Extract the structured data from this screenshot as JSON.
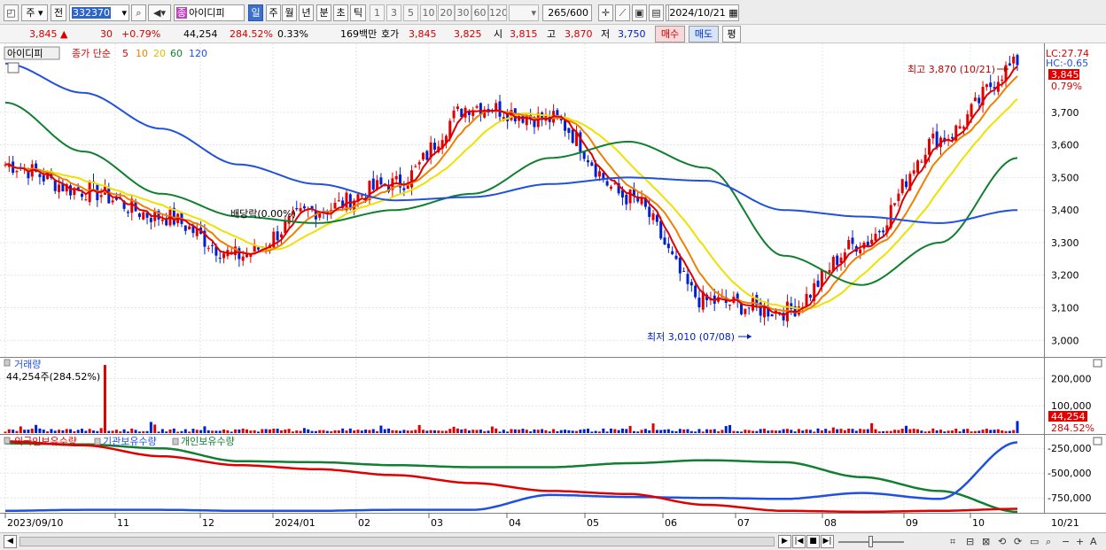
{
  "toolbar": {
    "market": "주",
    "prev_label": "전",
    "stock_code": "332370",
    "stock_name_prefix": "종",
    "stock_name": "아이디피",
    "period_tabs": [
      "일",
      "주",
      "월",
      "년",
      "분",
      "초",
      "틱"
    ],
    "active_period": "일",
    "interval_options": [
      "1",
      "3",
      "5",
      "10",
      "20",
      "30",
      "60",
      "120"
    ],
    "display_count": "265",
    "display_total": "/600",
    "date": "2024/10/21"
  },
  "quote": {
    "price": "3,845 ▲",
    "change": "30",
    "change_pct": "+0.79%",
    "volume": "44,254",
    "volume_ratio": "284.52%",
    "turnover": "0.33%",
    "amount": "169백만",
    "hoga_label": "호가",
    "ask": "3,845",
    "bid": "3,825",
    "open_label": "시",
    "open": "3,815",
    "high_label": "고",
    "high": "3,870",
    "low_label": "저",
    "low": "3,750",
    "buy_label": "매수",
    "sell_label": "매도",
    "eval_label": "평"
  },
  "price_panel": {
    "stock_tag": "아이디피",
    "ma_label": "종가 단순",
    "ma_periods": [
      {
        "period": "5",
        "color": "#e00000"
      },
      {
        "period": "10",
        "color": "#f08000"
      },
      {
        "period": "20",
        "color": "#f0e000"
      },
      {
        "period": "60",
        "color": "#108030"
      },
      {
        "period": "120",
        "color": "#2050e0"
      }
    ],
    "lc_label": "LC:27.74",
    "hc_label": "HC:-0.65",
    "current_price_badge": "3,845",
    "current_pct_badge": "0.79%",
    "high_annotation": "최고 3,870 (10/21)",
    "low_annotation": "최저 3,010 (07/08)",
    "dividend_label": "배당락(0.00%)",
    "y_ticks": [
      "3,700",
      "3,600",
      "3,500",
      "3,400",
      "3,300",
      "3,200",
      "3,100",
      "3,000"
    ]
  },
  "volume_panel": {
    "title": "거래량",
    "value_label": "44,254주(284.52%)",
    "y_ticks": [
      "200,000",
      "100,000"
    ],
    "badge_value": "44,254",
    "badge_pct": "284.52%"
  },
  "holding_panel": {
    "legend": [
      {
        "name": "외국인보유수량",
        "color": "#e00000"
      },
      {
        "name": "기관보유수량",
        "color": "#2050e0"
      },
      {
        "name": "개인보유수량",
        "color": "#108030"
      }
    ],
    "y_ticks": [
      "-250,000",
      "-500,000",
      "-750,000"
    ]
  },
  "x_axis": {
    "labels": [
      "2023/09/10",
      "11",
      "12",
      "2024/01",
      "02",
      "03",
      "04",
      "05",
      "06",
      "07",
      "08",
      "09",
      "10"
    ],
    "right_label": "10/21"
  },
  "colors": {
    "up": "#e00000",
    "down": "#0020d0",
    "ma5": "#e00000",
    "ma10": "#f08000",
    "ma20": "#f0e000",
    "ma60": "#108030",
    "ma120": "#2050e0"
  },
  "chart_data": {
    "type": "line",
    "title": "아이디피",
    "x": [
      "2023/09",
      "2023/10",
      "2023/11",
      "2023/12",
      "2024/01",
      "2024/02",
      "2024/03",
      "2024/04",
      "2024/05",
      "2024/06",
      "2024/07",
      "2024/08",
      "2024/09",
      "2024/10"
    ],
    "series": [
      {
        "name": "종가",
        "values": [
          3540,
          3460,
          3380,
          3260,
          3400,
          3480,
          3720,
          3680,
          3440,
          3120,
          3090,
          3300,
          3620,
          3845
        ]
      },
      {
        "name": "60",
        "values": [
          3730,
          3580,
          3450,
          3380,
          3360,
          3400,
          3450,
          3560,
          3610,
          3530,
          3260,
          3170,
          3300,
          3560
        ]
      },
      {
        "name": "120",
        "values": [
          3850,
          3760,
          3650,
          3540,
          3480,
          3430,
          3440,
          3480,
          3500,
          3490,
          3400,
          3380,
          3360,
          3400
        ]
      }
    ],
    "ylim": [
      2960,
      3890
    ],
    "high": {
      "value": 3870,
      "date": "10/21"
    },
    "low": {
      "value": 3010,
      "date": "07/08"
    }
  }
}
